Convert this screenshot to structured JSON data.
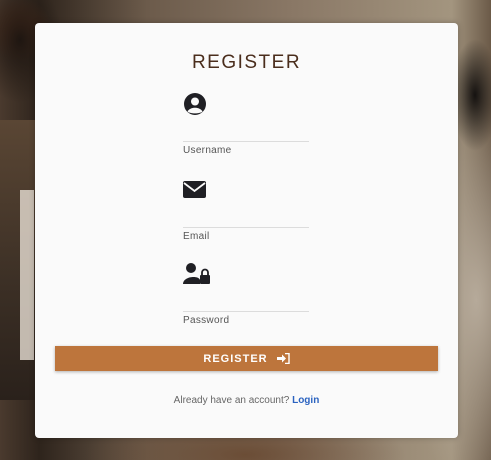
{
  "form": {
    "title": "REGISTER",
    "fields": [
      {
        "label": "Username",
        "icon": "user-circle-icon"
      },
      {
        "label": "Email",
        "icon": "envelope-icon"
      },
      {
        "label": "Password",
        "icon": "user-lock-icon"
      }
    ],
    "submit_label": "REGISTER",
    "submit_icon": "sign-in-icon"
  },
  "footer": {
    "prompt": "Already have an account?",
    "link_label": "Login"
  },
  "colors": {
    "accent": "#bd753c",
    "title": "#4a2d1c",
    "link": "#2b63c0"
  }
}
